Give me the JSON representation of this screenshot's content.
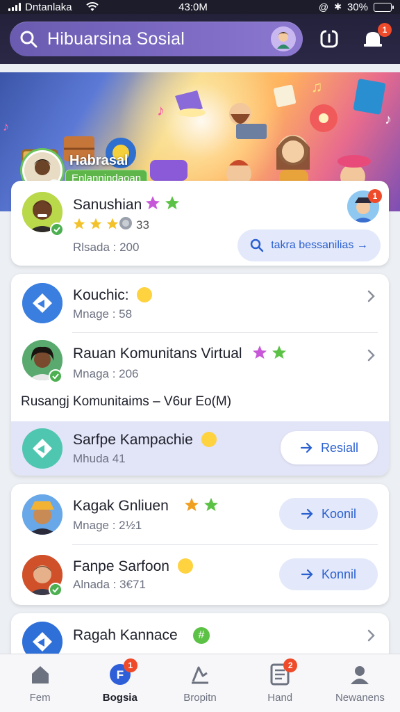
{
  "status_bar": {
    "carrier": "Dntanlaka",
    "time": "43:0M",
    "battery": "30%",
    "battery_level": 0.3
  },
  "header": {
    "search_text": "Hibuarsina Sosial",
    "notification_count": "1"
  },
  "banner": {
    "name": "Habrasal",
    "tag": "Enlannindaoan"
  },
  "profile_card": {
    "name": "Sanushian",
    "rating_stars": 3,
    "coin_value": "33",
    "sub": "Rlsada : 200",
    "badge_count": "1",
    "action_label": "takra bessanilias →"
  },
  "group_card": {
    "items": [
      {
        "title": "Kouchic:",
        "sub": "Mnage : 58"
      },
      {
        "title": "Rauan Komunitans Virtual",
        "sub": "Mnaga : 206"
      }
    ],
    "section_label": "Rusangj Komunitaims – V6ur Eo(M)",
    "highlight": {
      "title": "Sarfpe Kampachie",
      "sub": "Mhuda  41",
      "button": "Resiall"
    }
  },
  "friends_card": {
    "items": [
      {
        "title": "Kagak Gnliuen",
        "sub": "Mnage : 2½1",
        "button": "Koonil"
      },
      {
        "title": "Fanpe Sarfoon",
        "sub": "Alnada : 3€71",
        "button": "Konnil"
      }
    ]
  },
  "partial_card": {
    "title": "Ragah Kannace"
  },
  "bottom_nav": {
    "items": [
      {
        "label": "Fem",
        "icon": "home-icon"
      },
      {
        "label": "Bogsia",
        "icon": "community-icon",
        "badge": "1"
      },
      {
        "label": "Bropitn",
        "icon": "explore-icon"
      },
      {
        "label": "Hand",
        "icon": "document-icon",
        "badge": "2"
      },
      {
        "label": "Newanens",
        "icon": "profile-icon"
      }
    ],
    "active_index": 1
  },
  "colors": {
    "accent": "#2a5fd0",
    "header_bg": "#23213a",
    "search_bg": "#7d6bc4",
    "badge": "#ef4b2b",
    "verified": "#4caf50"
  }
}
